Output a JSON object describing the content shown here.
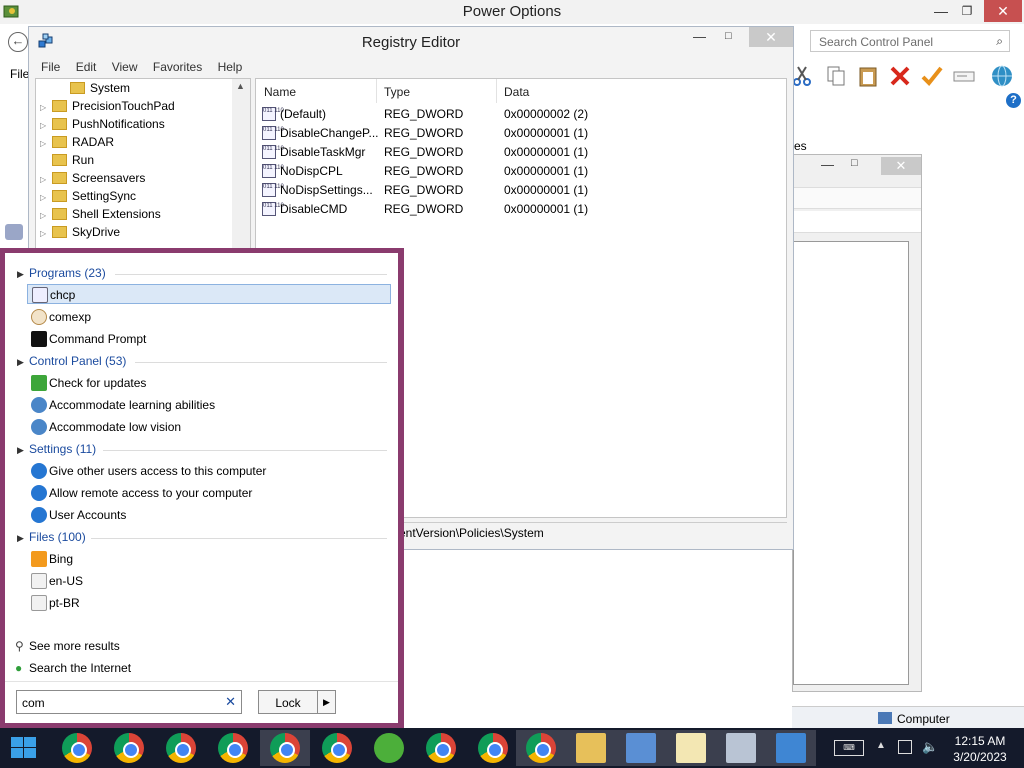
{
  "power_options": {
    "title": "Power Options",
    "window_controls": {
      "minimize": "—",
      "maximize": "❐",
      "close": "✕"
    },
    "back_glyph": "←",
    "search_placeholder": "Search Control Panel",
    "search_glyph": "⌕",
    "menu_file": "File",
    "partial_text": "es",
    "help_glyph": "?",
    "status_text": "Computer",
    "toolbar_icons": [
      "scissors-icon",
      "copy-icon",
      "paste-icon",
      "delete-icon",
      "check-icon",
      "rename-icon",
      "globe-icon"
    ]
  },
  "window2": {
    "minimize": "—",
    "maximize": "□",
    "close": "✕"
  },
  "registry": {
    "title": "Registry Editor",
    "window_controls": {
      "minimize": "—",
      "maximize": "□",
      "close": "✕"
    },
    "menu": [
      "File",
      "Edit",
      "View",
      "Favorites",
      "Help"
    ],
    "tree": [
      {
        "label": "System",
        "arrow": ""
      },
      {
        "label": "PrecisionTouchPad",
        "arrow": "▷"
      },
      {
        "label": "PushNotifications",
        "arrow": "▷"
      },
      {
        "label": "RADAR",
        "arrow": "▷"
      },
      {
        "label": "Run",
        "arrow": ""
      },
      {
        "label": "Screensavers",
        "arrow": "▷"
      },
      {
        "label": "SettingSync",
        "arrow": "▷"
      },
      {
        "label": "Shell Extensions",
        "arrow": "▷"
      },
      {
        "label": "SkyDrive",
        "arrow": "▷"
      }
    ],
    "tree_scroll_glyph": "▲",
    "columns": {
      "name": "Name",
      "type": "Type",
      "data": "Data"
    },
    "values": [
      {
        "name": "(Default)",
        "type": "REG_DWORD",
        "data": "0x00000002 (2)"
      },
      {
        "name": "DisableChangeP...",
        "type": "REG_DWORD",
        "data": "0x00000001 (1)"
      },
      {
        "name": "DisableTaskMgr",
        "type": "REG_DWORD",
        "data": "0x00000001 (1)"
      },
      {
        "name": "NoDispCPL",
        "type": "REG_DWORD",
        "data": "0x00000001 (1)"
      },
      {
        "name": "NoDispSettings...",
        "type": "REG_DWORD",
        "data": "0x00000001 (1)"
      },
      {
        "name": "DisableCMD",
        "type": "REG_DWORD",
        "data": "0x00000001 (1)"
      }
    ],
    "value_icon_text": "011\n110",
    "status_path": "entVersion\\Policies\\System"
  },
  "start_search": {
    "groups": [
      {
        "label": "Programs (23)",
        "items": [
          "chcp",
          "comexp",
          "Command Prompt"
        ]
      },
      {
        "label": "Control Panel (53)",
        "items": [
          "Check for updates",
          "Accommodate learning abilities",
          "Accommodate low vision"
        ]
      },
      {
        "label": "Settings (11)",
        "items": [
          "Give other users access to this computer",
          "Allow remote access to your computer",
          "User Accounts"
        ]
      },
      {
        "label": "Files (100)",
        "items": [
          "Bing",
          "en-US",
          "pt-BR"
        ]
      }
    ],
    "group_arrow": "▶",
    "see_more": "See more results",
    "search_internet": "Search the Internet",
    "see_more_glyph": "⚲",
    "search_internet_glyph": "●",
    "query": "com",
    "clear_glyph": "✕",
    "lock_label": "Lock",
    "lock_arrow": "▶"
  },
  "taskbar": {
    "apps": [
      "chrome-icon",
      "chrome-user-icon",
      "chrome-user-icon",
      "chrome-icon",
      "chrome-profile-icon",
      "chrome-profile-icon",
      "ccleaner-icon",
      "chrome-user-icon",
      "chrome-user-icon",
      "chrome-icon",
      "file-explorer-icon",
      "control-panel-icon",
      "notepad-icon",
      "resource-monitor-icon",
      "registry-editor-icon"
    ],
    "tray_up_glyph": "▲",
    "tray_kbd_glyph": "⌨",
    "tray_vol_glyph": "🔈",
    "time": "12:15 AM",
    "date": "3/20/2023"
  }
}
